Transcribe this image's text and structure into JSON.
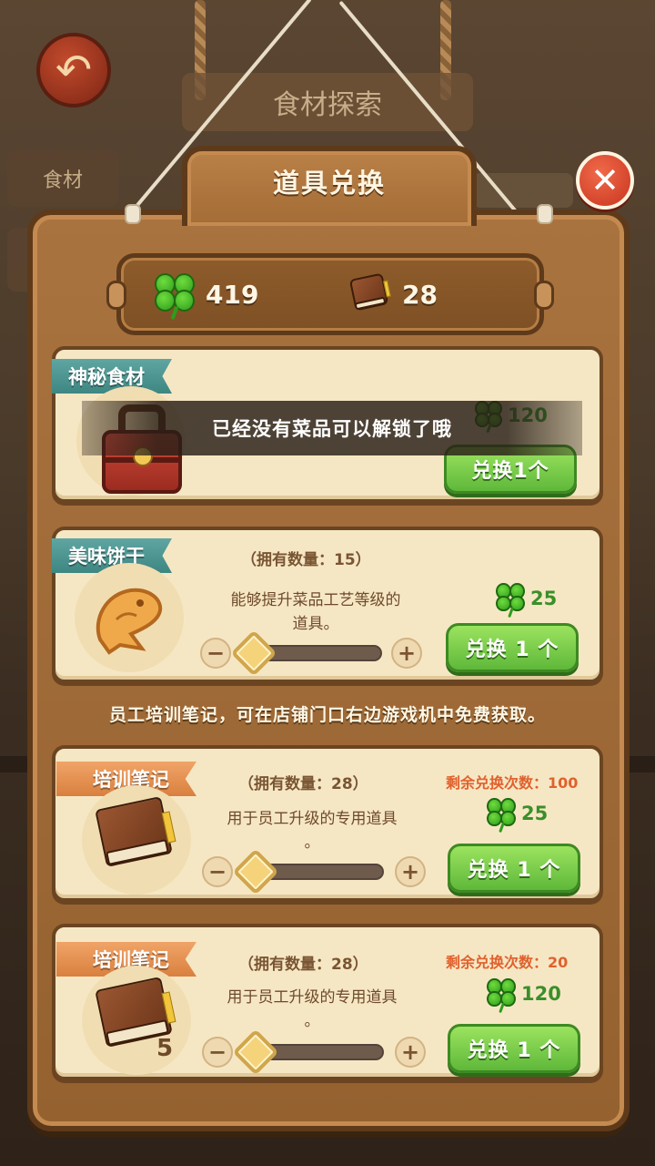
{
  "background": {
    "sign_label": "食材探索",
    "tab_label": "食材"
  },
  "dialog": {
    "title": "道具兑换",
    "close_label": "✕"
  },
  "currency": {
    "clover_count": "419",
    "book_count": "28"
  },
  "toast": {
    "message": "已经没有菜品可以解锁了哦"
  },
  "cards": [
    {
      "name": "神秘食材",
      "price": "120",
      "button": "兑换1个"
    },
    {
      "name": "美味饼干",
      "owned": "（拥有数量：15）",
      "description_line1": "能够提升菜品工艺等级的",
      "description_line2": "道具。",
      "price": "25",
      "button": "兑换 1 个",
      "stepper_minus": "−",
      "stepper_plus": "+"
    },
    {
      "name": "培训笔记",
      "owned": "（拥有数量：28）",
      "remaining": "剩余兑换次数：100",
      "description_line1": "用于员工升级的专用道具",
      "description_line2": "。",
      "price": "25",
      "button": "兑换 1 个",
      "stepper_minus": "−",
      "stepper_plus": "+"
    },
    {
      "name": "培训笔记",
      "owned": "（拥有数量：28）",
      "remaining": "剩余兑换次数：20",
      "description_line1": "用于员工升级的专用道具",
      "description_line2": "。",
      "price": "120",
      "button": "兑换 1 个",
      "badge_count": "5",
      "stepper_minus": "−",
      "stepper_plus": "+"
    }
  ],
  "info_text": "员工培训笔记，可在店铺门口右边游戏机中免费获取。",
  "icons": {
    "clover": "clover-icon",
    "book": "book-icon",
    "lunchbox": "lunchbox-icon",
    "biscuit": "fish-biscuit-icon",
    "back": "back-arrow-icon",
    "close": "close-icon"
  },
  "colors": {
    "wood": "#a9733f",
    "card": "#f6e7c4",
    "green_button": "#5fb83a",
    "ribbon_teal": "#3e8682",
    "ribbon_orange": "#d9803f",
    "remaining_text": "#e0612e",
    "close_red": "#c8351f"
  }
}
